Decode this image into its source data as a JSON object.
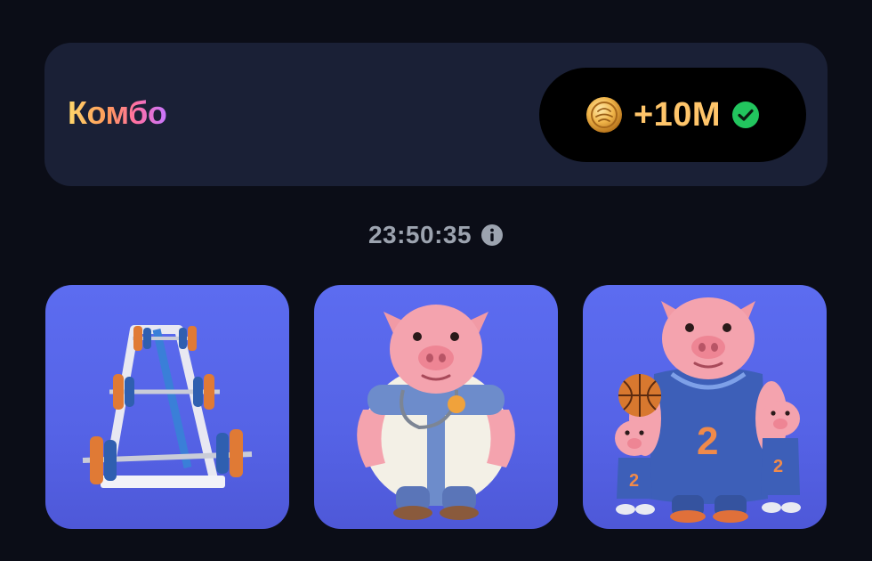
{
  "combo": {
    "title": "Комбо",
    "reward": "+10M",
    "reward_icon": "coin-icon",
    "status_icon": "check-circle-icon",
    "colors": {
      "panel": "#1a2036",
      "pill": "#000000",
      "reward_text": "#ffc56a",
      "check": "#22c55e"
    }
  },
  "timer": {
    "value": "23:50:35",
    "icon": "info-icon"
  },
  "cards": [
    {
      "icon": "barbell-rack-icon"
    },
    {
      "icon": "doctor-pig-icon"
    },
    {
      "icon": "basketball-pig-family-icon"
    }
  ],
  "colors": {
    "background": "#0b0d17",
    "card": "#5563e6",
    "muted_text": "#9ca3af"
  }
}
